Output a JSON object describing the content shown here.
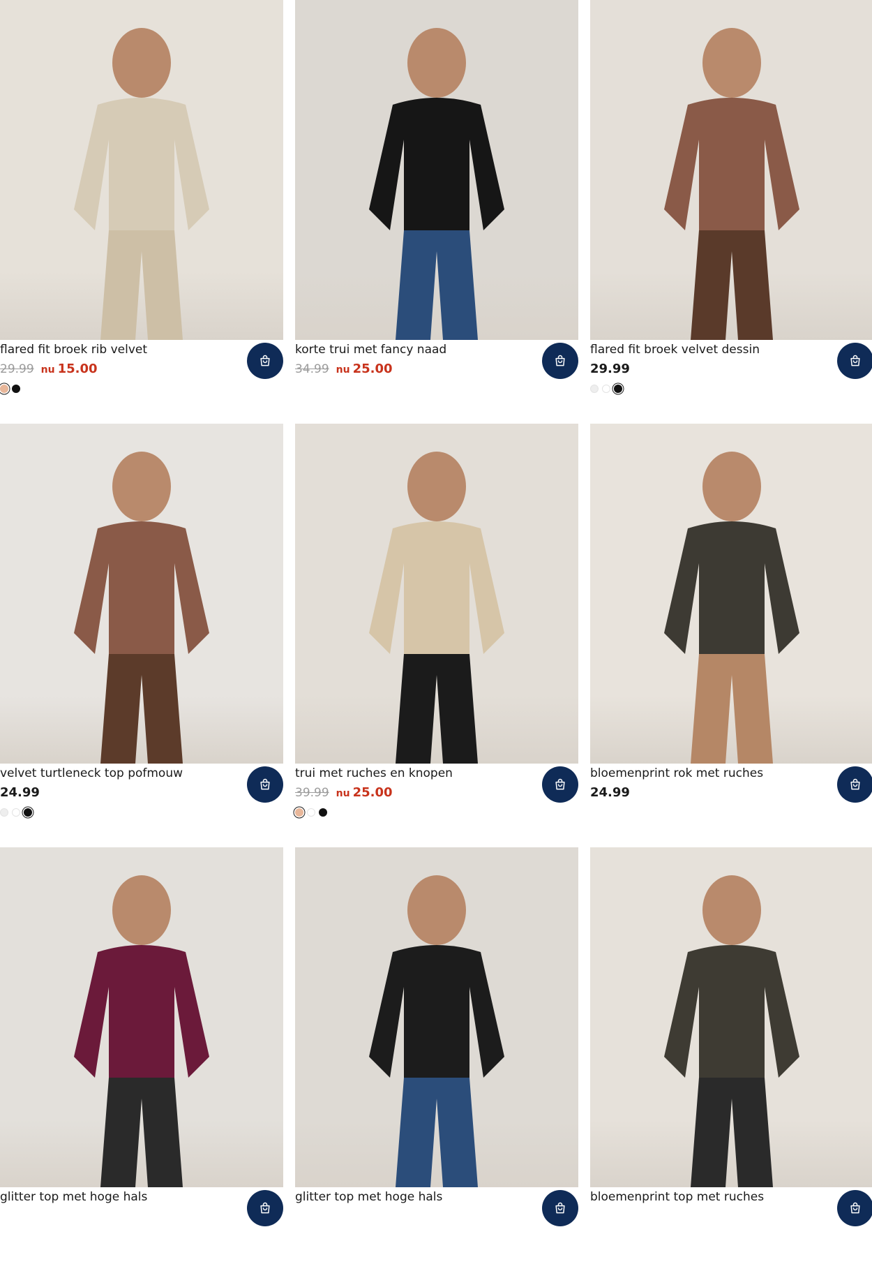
{
  "products": [
    {
      "title": "flared fit broek rib velvet",
      "old_price": "29.99",
      "now_label": "nu",
      "price": "15.00",
      "on_sale": true,
      "swatches": [
        {
          "color": "#e8b79a",
          "selected": true
        },
        {
          "color": "#111111",
          "selected": false
        }
      ],
      "photo": {
        "bg": "#e6e1d9",
        "garment": "#d6cbb6",
        "accent": "#cdbfa6"
      }
    },
    {
      "title": "korte trui met fancy naad",
      "old_price": "34.99",
      "now_label": "nu",
      "price": "25.00",
      "on_sale": true,
      "swatches": [],
      "photo": {
        "bg": "#dcd8d2",
        "garment": "#161616",
        "accent": "#2b4d7a"
      }
    },
    {
      "title": "flared fit broek velvet dessin",
      "price": "29.99",
      "on_sale": false,
      "swatches": [
        {
          "color": "#eeeeee",
          "selected": false
        },
        {
          "color": "#ffffff",
          "selected": false
        },
        {
          "color": "#111111",
          "selected": true
        }
      ],
      "photo": {
        "bg": "#e4dfd8",
        "garment": "#8a5a48",
        "accent": "#5a3a2a"
      }
    },
    {
      "title": "velvet turtleneck top pofmouw",
      "price": "24.99",
      "on_sale": false,
      "swatches": [
        {
          "color": "#eeeeee",
          "selected": false
        },
        {
          "color": "#ffffff",
          "selected": false
        },
        {
          "color": "#111111",
          "selected": true
        }
      ],
      "photo": {
        "bg": "#e7e4e0",
        "garment": "#8a5a48",
        "accent": "#5c3b2a"
      }
    },
    {
      "title": "trui met ruches en knopen",
      "old_price": "39.99",
      "now_label": "nu",
      "price": "25.00",
      "on_sale": true,
      "swatches": [
        {
          "color": "#e8b79a",
          "selected": true
        },
        {
          "color": "#ffffff",
          "selected": false
        },
        {
          "color": "#111111",
          "selected": false
        }
      ],
      "photo": {
        "bg": "#e3ded7",
        "garment": "#d6c5a8",
        "accent": "#1b1b1b"
      }
    },
    {
      "title": "bloemenprint rok met ruches",
      "price": "24.99",
      "on_sale": false,
      "swatches": [],
      "photo": {
        "bg": "#e8e3dc",
        "garment": "#3d3a33",
        "accent": "#b58766"
      }
    },
    {
      "title": "glitter top met hoge hals",
      "on_sale": false,
      "swatches": [],
      "photo": {
        "bg": "#e3e0db",
        "garment": "#6b1a3a",
        "accent": "#2a2a2a"
      }
    },
    {
      "title": "glitter top met hoge hals",
      "on_sale": false,
      "swatches": [],
      "photo": {
        "bg": "#dedad4",
        "garment": "#1c1c1c",
        "accent": "#2b4d7a"
      }
    },
    {
      "title": "bloemenprint top met ruches",
      "on_sale": false,
      "swatches": [],
      "photo": {
        "bg": "#e6e1da",
        "garment": "#3e3b33",
        "accent": "#2a2a2a"
      }
    }
  ],
  "icons": {
    "cart": "shopping-bag-icon"
  },
  "colors": {
    "cart_button": "#0f2b57",
    "sale": "#c8331c",
    "old_price": "#9b9b9b"
  }
}
